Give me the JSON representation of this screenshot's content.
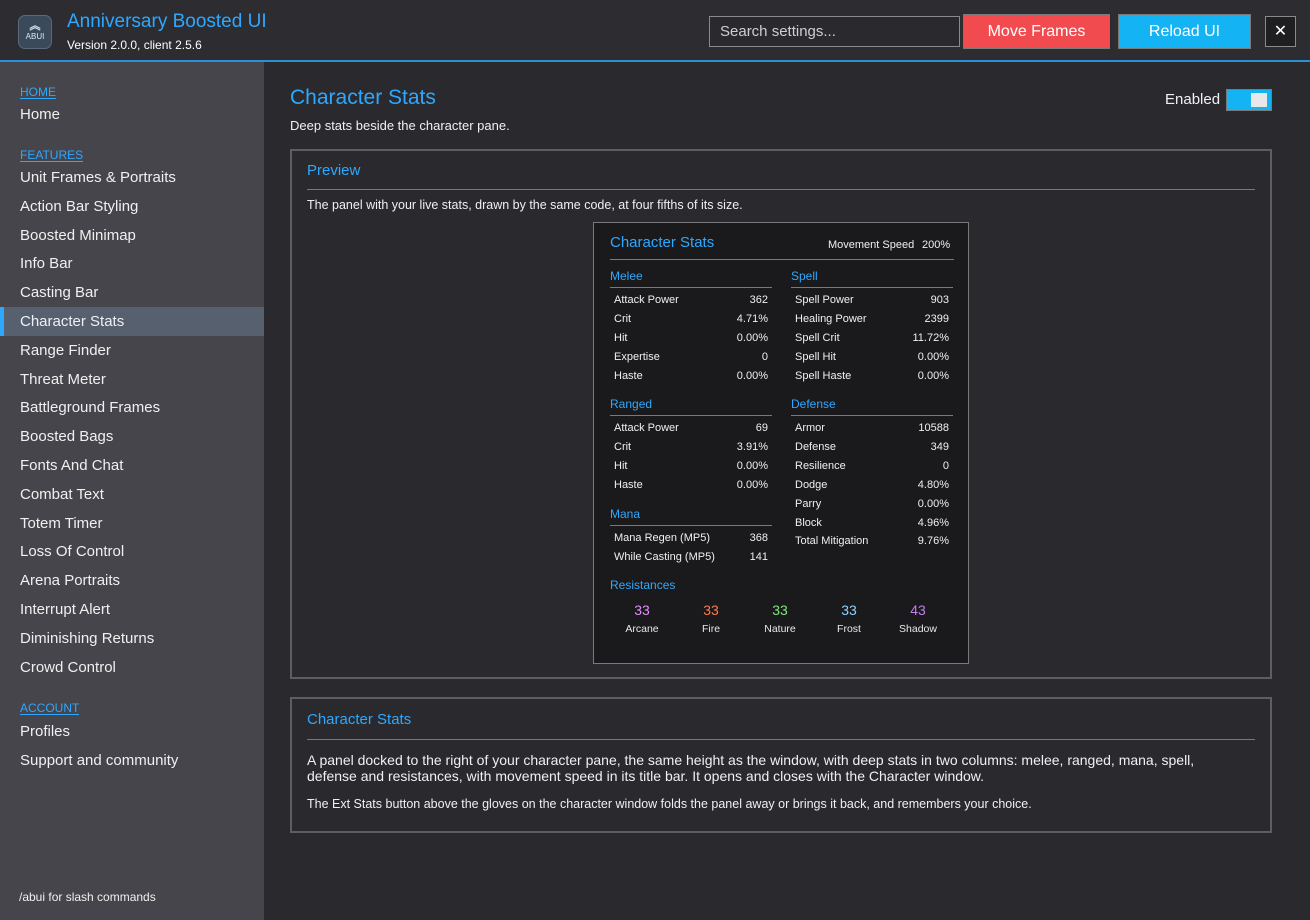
{
  "header": {
    "logo_text": "ABUI",
    "title": "Anniversary Boosted UI",
    "version": "Version 2.0.0, client 2.5.6",
    "search_placeholder": "Search settings...",
    "move_frames": "Move Frames",
    "reload_ui": "Reload UI",
    "close": "✕"
  },
  "sidebar": {
    "sections": [
      "HOME",
      "FEATURES",
      "ACCOUNT"
    ],
    "home_items": [
      "Home"
    ],
    "feature_items": [
      "Unit Frames & Portraits",
      "Action Bar Styling",
      "Boosted Minimap",
      "Info Bar",
      "Casting Bar",
      "Character Stats",
      "Range Finder",
      "Threat Meter",
      "Battleground Frames",
      "Boosted Bags",
      "Fonts And Chat",
      "Combat Text",
      "Totem Timer",
      "Loss Of Control",
      "Arena Portraits",
      "Interrupt Alert",
      "Diminishing Returns",
      "Crowd Control"
    ],
    "account_items": [
      "Profiles",
      "Support and community"
    ],
    "active_item": "Character Stats",
    "footer": "/abui for slash commands"
  },
  "main": {
    "title": "Character Stats",
    "subtitle": "Deep stats beside the character pane.",
    "enabled_label": "Enabled",
    "enabled": true,
    "preview": {
      "title": "Preview",
      "description": "The panel with your live stats, drawn by the same code, at four fifths of its size.",
      "card": {
        "title": "Character Stats",
        "movement_label": "Movement Speed",
        "movement_value": "200%",
        "melee": {
          "title": "Melee",
          "stats": [
            [
              "Attack Power",
              "362"
            ],
            [
              "Crit",
              "4.71%"
            ],
            [
              "Hit",
              "0.00%"
            ],
            [
              "Expertise",
              "0"
            ],
            [
              "Haste",
              "0.00%"
            ]
          ]
        },
        "ranged": {
          "title": "Ranged",
          "stats": [
            [
              "Attack Power",
              "69"
            ],
            [
              "Crit",
              "3.91%"
            ],
            [
              "Hit",
              "0.00%"
            ],
            [
              "Haste",
              "0.00%"
            ]
          ]
        },
        "mana": {
          "title": "Mana",
          "stats": [
            [
              "Mana Regen (MP5)",
              "368"
            ],
            [
              "While Casting (MP5)",
              "141"
            ]
          ]
        },
        "spell": {
          "title": "Spell",
          "stats": [
            [
              "Spell Power",
              "903"
            ],
            [
              "Healing Power",
              "2399"
            ],
            [
              "Spell Crit",
              "11.72%"
            ],
            [
              "Spell Hit",
              "0.00%"
            ],
            [
              "Spell Haste",
              "0.00%"
            ]
          ]
        },
        "defense": {
          "title": "Defense",
          "stats": [
            [
              "Armor",
              "10588"
            ],
            [
              "Defense",
              "349"
            ],
            [
              "Resilience",
              "0"
            ],
            [
              "Dodge",
              "4.80%"
            ],
            [
              "Parry",
              "0.00%"
            ],
            [
              "Block",
              "4.96%"
            ],
            [
              "Total Mitigation",
              "9.76%"
            ]
          ]
        },
        "resistances": {
          "title": "Resistances",
          "items": [
            {
              "name": "Arcane",
              "value": "33",
              "color": "#e08cff"
            },
            {
              "name": "Fire",
              "value": "33",
              "color": "#ff7a4a"
            },
            {
              "name": "Nature",
              "value": "33",
              "color": "#7de87d"
            },
            {
              "name": "Frost",
              "value": "33",
              "color": "#8cd0ff"
            },
            {
              "name": "Shadow",
              "value": "43",
              "color": "#c47cf0"
            }
          ]
        }
      }
    },
    "info": {
      "title": "Character Stats",
      "paragraph1": "A panel docked to the right of your character pane, the same height as the window, with deep stats in two columns: melee, ranged, mana, spell, defense and resistances, with movement speed in its title bar.  It opens and closes with the Character window.",
      "paragraph2": "The Ext Stats button above the gloves on the character window folds the panel away or brings it back, and remembers your choice."
    }
  }
}
